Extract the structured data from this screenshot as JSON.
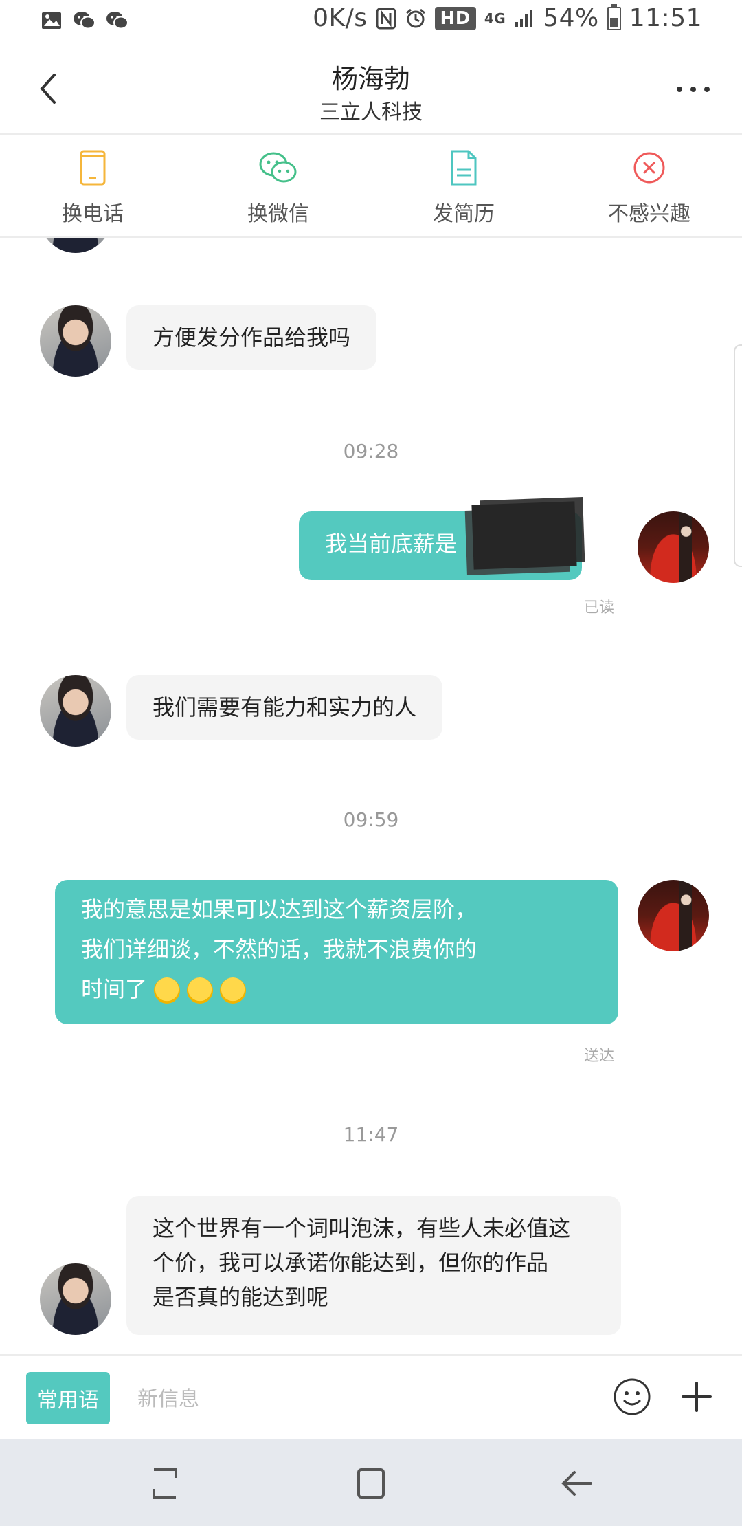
{
  "status_bar": {
    "network_speed": "0K/s",
    "network_type": "4G",
    "hd_label": "HD",
    "battery": "54%",
    "time": "11:51",
    "left_icons": [
      "gallery-icon",
      "wechat-icon",
      "wechat-icon"
    ]
  },
  "header": {
    "title": "杨海勃",
    "subtitle": "三立人科技"
  },
  "actions": [
    {
      "label": "换电话",
      "icon": "phone-icon",
      "color": "#f5b63b"
    },
    {
      "label": "换微信",
      "icon": "wechat-icon",
      "color": "#45c08a"
    },
    {
      "label": "发简历",
      "icon": "resume-icon",
      "color": "#4ec6c0"
    },
    {
      "label": "不感兴趣",
      "icon": "close-circle-icon",
      "color": "#ef5a5a"
    }
  ],
  "messages": {
    "m1": {
      "text": "方便发分作品给我吗"
    },
    "t1": "09:28",
    "m2": {
      "text": "我当前底薪是",
      "status": "已读"
    },
    "m3": {
      "text": "我们需要有能力和实力的人"
    },
    "t2": "09:59",
    "m4": {
      "line1": "我的意思是如果可以达到这个薪资层阶，",
      "line2": "我们详细谈，不然的话，我就不浪费你的",
      "line3": "时间了",
      "status": "送达"
    },
    "t3": "11:47",
    "m5": {
      "line1": "这个世界有一个词叫泡沫，有些人未必值这",
      "line2": "个价，我可以承诺你能达到，但你的作品",
      "line3": "是否真的能达到呢"
    }
  },
  "input": {
    "phrases_label": "常用语",
    "placeholder": "新信息"
  },
  "colors": {
    "accent": "#54c9bf",
    "incoming_bubble": "#f4f4f4"
  }
}
